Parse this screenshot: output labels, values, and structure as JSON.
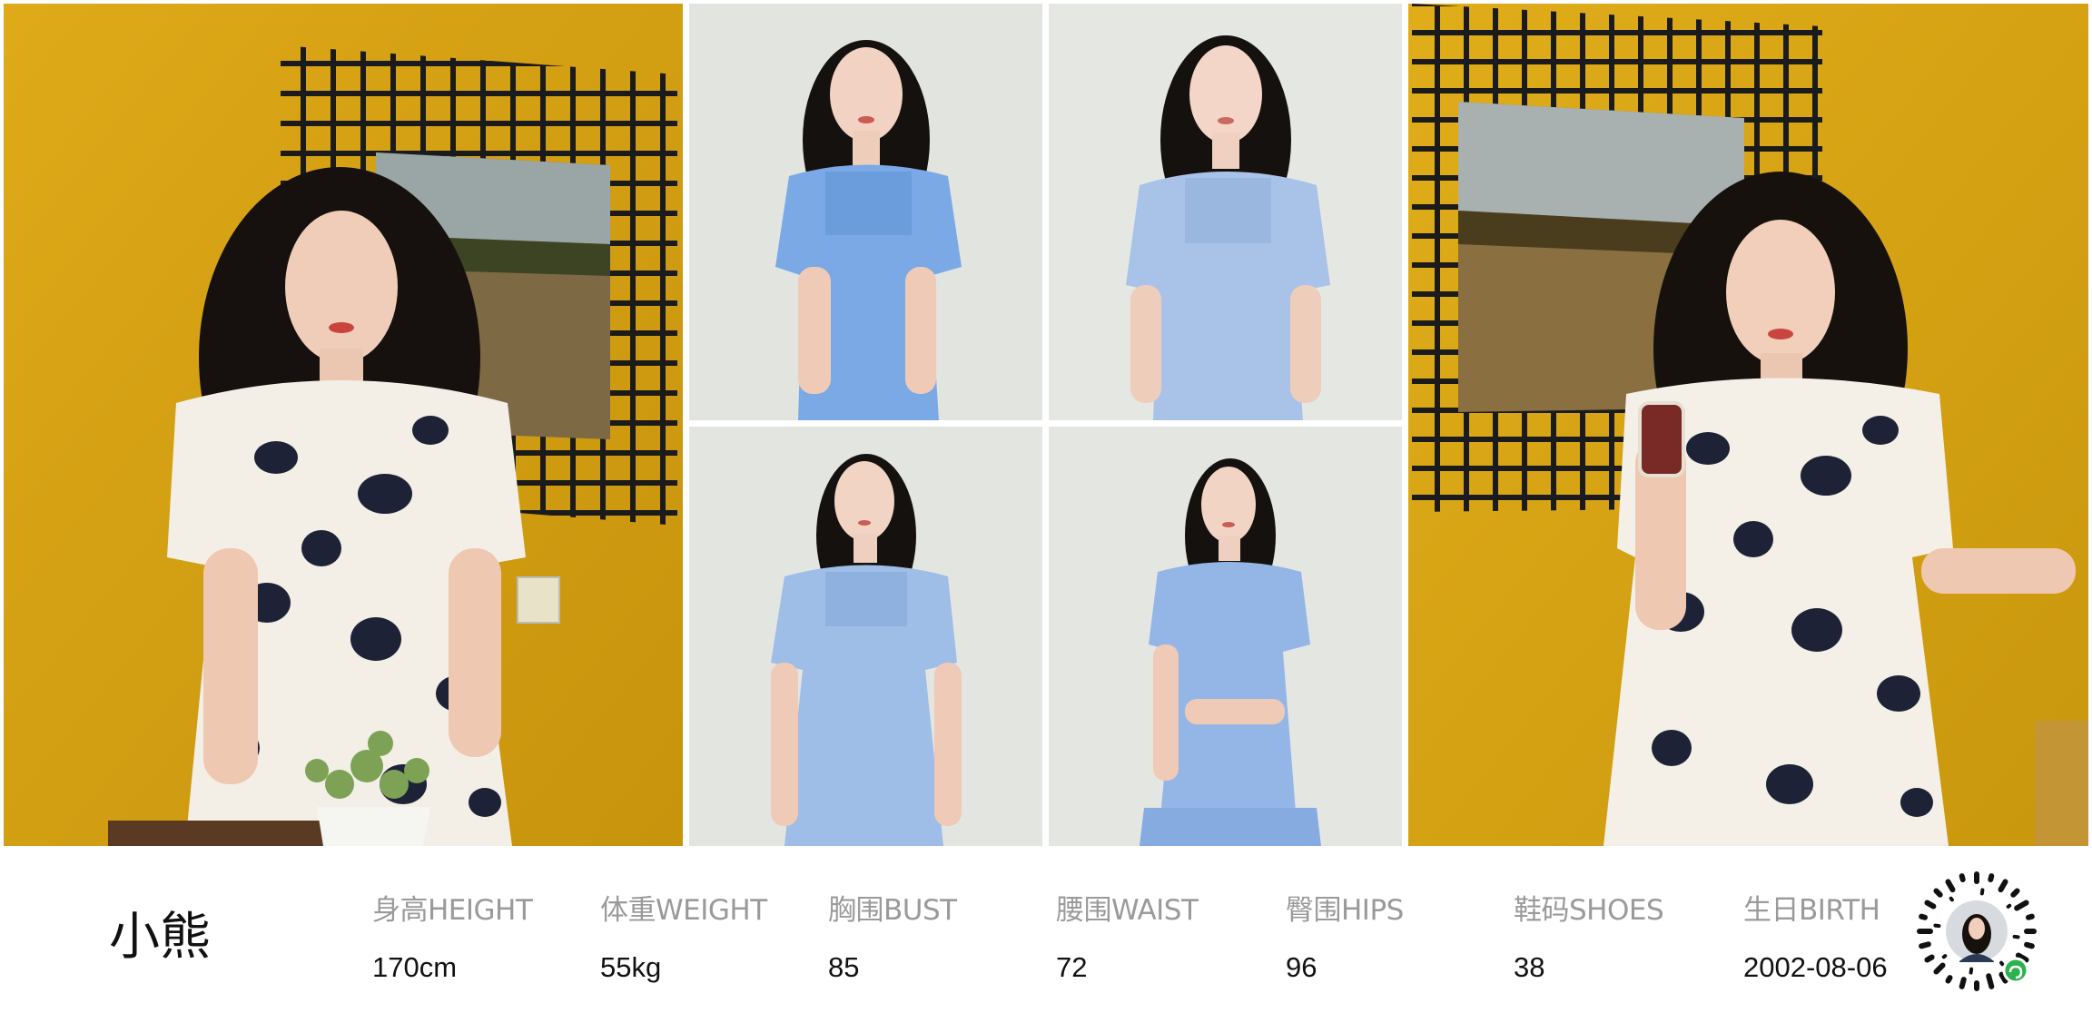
{
  "model": {
    "name": "小熊"
  },
  "stats": [
    {
      "label": "身高HEIGHT",
      "value": "170cm"
    },
    {
      "label": "体重WEIGHT",
      "value": "55kg"
    },
    {
      "label": "胸围BUST",
      "value": "85"
    },
    {
      "label": "腰围WAIST",
      "value": "72"
    },
    {
      "label": "臀围HIPS",
      "value": "96"
    },
    {
      "label": "鞋码SHOES",
      "value": "38"
    },
    {
      "label": "生日BIRTH",
      "value": "2002-08-06"
    }
  ],
  "colors": {
    "wall_yellow": "#d9a30c",
    "studio_grey": "#e4e6e3",
    "dress_blue": "#8db4e6",
    "floral_navy": "#1d2236",
    "qr_badge_green": "#2bb24c"
  },
  "icons": [
    "qr-code-icon",
    "mini-program-badge-icon"
  ]
}
